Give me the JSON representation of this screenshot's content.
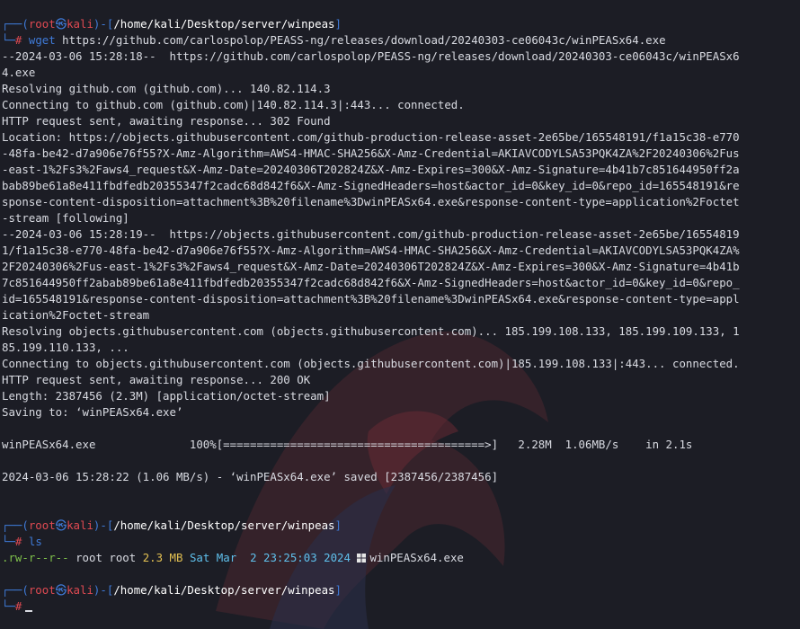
{
  "colors": {
    "background": "#1c1d25",
    "prompt_frame": "#3f7bd9",
    "prompt_user": "#e04a52",
    "text": "#d9dbe2",
    "command": "#3f7bd9"
  },
  "prompt1": {
    "frame_top_open": "┌──(",
    "user": "root",
    "at": "㉿",
    "host": "kali",
    "mid": ")-[",
    "cwd": "/home/kali/Desktop/server/winpeas",
    "end": "]",
    "frame_bottom": "└─",
    "hash": "#",
    "command": "wget",
    "args": " https://github.com/carlospolop/PEASS-ng/releases/download/20240303-ce06043c/winPEASx64.exe"
  },
  "output": [
    "--2024-03-06 15:28:18--  https://github.com/carlospolop/PEASS-ng/releases/download/20240303-ce06043c/winPEASx6",
    "4.exe",
    "Resolving github.com (github.com)... 140.82.114.3",
    "Connecting to github.com (github.com)|140.82.114.3|:443... connected.",
    "HTTP request sent, awaiting response... 302 Found",
    "Location: https://objects.githubusercontent.com/github-production-release-asset-2e65be/165548191/f1a15c38-e770",
    "-48fa-be42-d7a906e76f55?X-Amz-Algorithm=AWS4-HMAC-SHA256&X-Amz-Credential=AKIAVCODYLSA53PQK4ZA%2F20240306%2Fus",
    "-east-1%2Fs3%2Faws4_request&X-Amz-Date=20240306T202824Z&X-Amz-Expires=300&X-Amz-Signature=4b41b7c851644950ff2a",
    "bab89be61a8e411fbdfedb20355347f2cadc68d842f6&X-Amz-SignedHeaders=host&actor_id=0&key_id=0&repo_id=165548191&re",
    "sponse-content-disposition=attachment%3B%20filename%3DwinPEASx64.exe&response-content-type=application%2Foctet",
    "-stream [following]",
    "--2024-03-06 15:28:19--  https://objects.githubusercontent.com/github-production-release-asset-2e65be/16554819",
    "1/f1a15c38-e770-48fa-be42-d7a906e76f55?X-Amz-Algorithm=AWS4-HMAC-SHA256&X-Amz-Credential=AKIAVCODYLSA53PQK4ZA%",
    "2F20240306%2Fus-east-1%2Fs3%2Faws4_request&X-Amz-Date=20240306T202824Z&X-Amz-Expires=300&X-Amz-Signature=4b41b",
    "7c851644950ff2abab89be61a8e411fbdfedb20355347f2cadc68d842f6&X-Amz-SignedHeaders=host&actor_id=0&key_id=0&repo_",
    "id=165548191&response-content-disposition=attachment%3B%20filename%3DwinPEASx64.exe&response-content-type=appl",
    "ication%2Foctet-stream",
    "Resolving objects.githubusercontent.com (objects.githubusercontent.com)... 185.199.108.133, 185.199.109.133, 1",
    "85.199.110.133, ...",
    "Connecting to objects.githubusercontent.com (objects.githubusercontent.com)|185.199.108.133|:443... connected.",
    "HTTP request sent, awaiting response... 200 OK",
    "Length: 2387456 (2.3M) [application/octet-stream]",
    "Saving to: ‘winPEASx64.exe’",
    "",
    "winPEASx64.exe              100%[=======================================>]   2.28M  1.06MB/s    in 2.1s",
    "",
    "2024-03-06 15:28:22 (1.06 MB/s) - ‘winPEASx64.exe’ saved [2387456/2387456]",
    "",
    ""
  ],
  "prompt2": {
    "command": "ls"
  },
  "ls_row": {
    "perms": ".rw-r--r--",
    "user": "root",
    "group": "root",
    "size": "2.3 MB",
    "date": "Sat Mar  2 23:25:03 2024",
    "icon": "windows-icon",
    "filename": "winPEASx64.exe"
  },
  "prompt3": {}
}
